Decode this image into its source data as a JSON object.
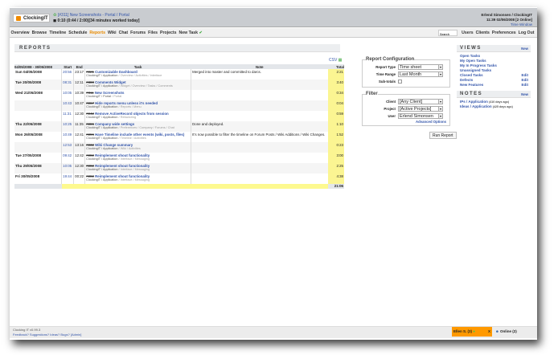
{
  "header": {
    "logo": "ClockingIT",
    "current_task": "[#311] New Screenshots - Portal / Portal",
    "timer": "0:10 (0:44 / 2:00)[34 minutes worked today]",
    "user": "Erlend Simonsen / ClockingIT",
    "datetime": "11:39 02/06/2008 [2 Online]",
    "time_window": "Time Window"
  },
  "nav": {
    "left": [
      "Overview",
      "Browse",
      "Timeline",
      "Schedule",
      "Reports",
      "Wiki",
      "Chat",
      "Forums",
      "Files",
      "Projects",
      "New Task"
    ],
    "active": "Reports",
    "search_placeholder": "Search",
    "right": [
      "Users",
      "Clients",
      "Preferences",
      "Log Out"
    ]
  },
  "reports": {
    "title": "REPORTS",
    "csv": "CSV",
    "headers": [
      "04/05/2008 - 30/05/2008",
      "Start",
      "End",
      "Task",
      "Note",
      "Total"
    ],
    "rows": [
      {
        "date": "Sun 04/05/2008",
        "start": "20:56",
        "end": "23:17",
        "id": "#221",
        "task": "Customizable Dashboard",
        "crumb": "ClockingIT / Application",
        "tags": "/ Overview / Activities / Interface",
        "note": "Merged into master and committed to darcs.",
        "total": "2:21"
      },
      {
        "date": "Tue 20/05/2008",
        "start": "08:31",
        "end": "12:11",
        "id": "#300",
        "task": "Comments Widget",
        "crumb": "ClockingIT / Application",
        "tags": "/ Widget / Overview / Tasks / Comments",
        "note": "",
        "total": "3:40"
      },
      {
        "date": "Wed 21/05/2008",
        "start": "10:05",
        "end": "10:39",
        "id": "#311",
        "task": "New Screenshots",
        "crumb": "ClockingIT / Portal",
        "tags": "/ Portal",
        "note": "",
        "total": "0:34"
      },
      {
        "date": "",
        "start": "10:43",
        "end": "10:47",
        "id": "#267",
        "task": "Hide reports menu unless it's needed",
        "crumb": "ClockingIT / Application",
        "tags": "/ Reports / Menu",
        "note": "",
        "total": "0:04"
      },
      {
        "date": "",
        "start": "11:31",
        "end": "12:30",
        "id": "#242",
        "task": "Remove ActiveRecord objects from session",
        "crumb": "ClockingIT / Application",
        "tags": "/ Refactoring",
        "note": "",
        "total": "0:59"
      },
      {
        "date": "Thu 22/05/2008",
        "start": "10:25",
        "end": "11:35",
        "id": "#286",
        "task": "Company wide settings",
        "crumb": "ClockingIT / Application",
        "tags": "/ Preferences / Company / Forums / Chat",
        "note": "Done and deployed.",
        "total": "1:10"
      },
      {
        "date": "Mon 26/05/2008",
        "start": "10:49",
        "end": "12:41",
        "id": "#296",
        "task": "Have Timeline include other events (wiki, posts, files)",
        "crumb": "ClockingIT / Application",
        "tags": "/ Timeline / Activities",
        "note": "It's now possible to filter the timeline on Forum Posts / Wiki Additions / Wiki Changes.",
        "total": "1:52"
      },
      {
        "date": "",
        "start": "12:53",
        "end": "13:16",
        "id": "#232",
        "task": "Wiki Change summary",
        "crumb": "ClockingIT / Application",
        "tags": "/ Wiki / Activities",
        "note": "",
        "total": "0:23"
      },
      {
        "date": "Tue 27/05/2008",
        "start": "09:42",
        "end": "12:42",
        "id": "#282",
        "task": "Reimplement shout functionality",
        "crumb": "ClockingIT / Application",
        "tags": "/ Interface / Messaging",
        "note": "",
        "total": "3:00"
      },
      {
        "date": "Thu 29/05/2008",
        "start": "10:05",
        "end": "12:30",
        "id": "#282",
        "task": "Reimplement shout functionality",
        "crumb": "ClockingIT / Application",
        "tags": "/ Interface / Messaging",
        "note": "",
        "total": "2:25"
      },
      {
        "date": "Fri 30/05/2008",
        "start": "19:44",
        "end": "00:22",
        "id": "#282",
        "task": "Reimplement shout functionality",
        "crumb": "ClockingIT / Application",
        "tags": "/ Interface / Messaging",
        "note": "",
        "total": "4:38"
      }
    ],
    "grand_total": "21:06"
  },
  "config": {
    "title": "Report Configuration",
    "report_type_label": "Report Type",
    "report_type": "Time sheet",
    "time_range_label": "Time Range",
    "time_range": "Last Month",
    "subtotals_label": "Sub-totals",
    "filter_title": "Filter",
    "client_label": "Client",
    "client": "[Any Client]",
    "project_label": "Project",
    "project": "[Active Projects]",
    "user_label": "User",
    "user": "Erlend Simonsen",
    "advanced": "Advanced Options",
    "run": "Run Report"
  },
  "views": {
    "title": "VIEWS",
    "new": "New",
    "items": [
      {
        "label": "Open Tasks",
        "edit": ""
      },
      {
        "label": "My Open Tasks",
        "edit": ""
      },
      {
        "label": "My In Progress Tasks",
        "edit": ""
      },
      {
        "label": "Unassigned Tasks",
        "edit": ""
      },
      {
        "label": "Closed Tasks",
        "edit": "Edit"
      },
      {
        "label": "Defects",
        "edit": "Edit"
      },
      {
        "label": "New Features",
        "edit": "Edit"
      }
    ]
  },
  "notes": {
    "title": "NOTES",
    "new": "New",
    "items": [
      {
        "label": "IPs / Application",
        "age": "(410 days ago)"
      },
      {
        "label": "Ideas / Application",
        "age": "(425 days ago)"
      }
    ]
  },
  "footer": {
    "version": "Clocking IT v0.99.3",
    "links": "Feedback? Suggestions? Ideas? Bugs? [Admin]",
    "chat": "Ellen S. (3)",
    "chat_close": "X",
    "online": "Online (2)"
  },
  "colors": {
    "accent": "#ff9900",
    "link": "#3355aa",
    "total_col": "#fbf592"
  }
}
